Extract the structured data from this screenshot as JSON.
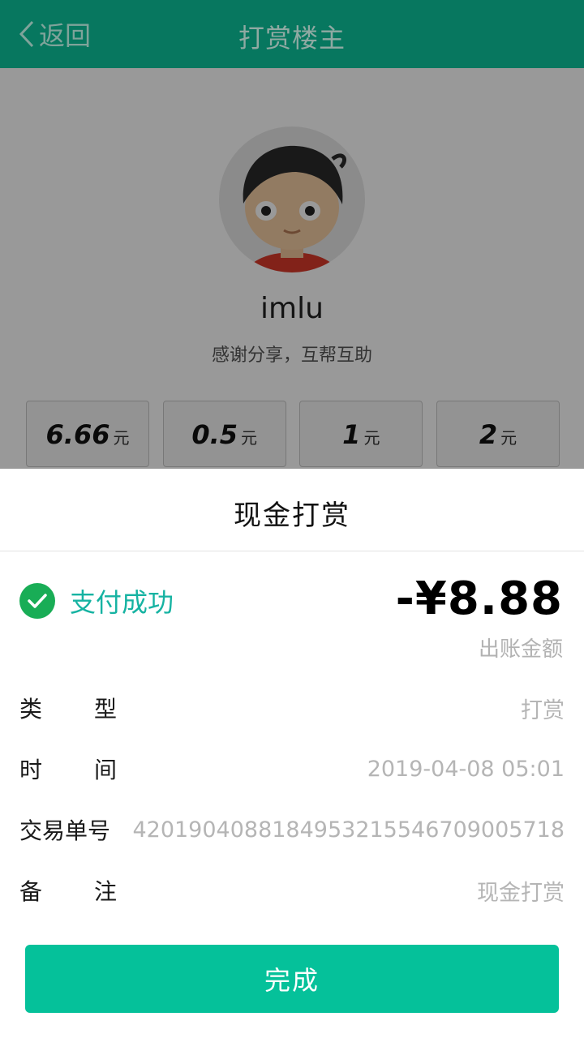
{
  "header": {
    "back_label": "返回",
    "title": "打赏楼主"
  },
  "profile": {
    "username": "imlu",
    "subtitle": "感谢分享，互帮互助"
  },
  "amount_options": [
    {
      "value": "6.66",
      "unit": "元"
    },
    {
      "value": "0.5",
      "unit": "元"
    },
    {
      "value": "1",
      "unit": "元"
    },
    {
      "value": "2",
      "unit": "元"
    }
  ],
  "sheet": {
    "title": "现金打赏",
    "status": "支付成功",
    "amount": "-¥8.88",
    "amount_label": "出账金额",
    "rows": [
      {
        "label": "类型",
        "value": "打赏"
      },
      {
        "label": "时间",
        "value": "2019-04-08 05:01"
      },
      {
        "label": "交易单号",
        "value": "4201904088184953215546709005718"
      },
      {
        "label": "备注",
        "value": "现金打赏"
      }
    ],
    "done_label": "完成"
  },
  "colors": {
    "header_bg": "#07775f",
    "success_green": "#19ad56",
    "status_text": "#16b3a2",
    "button_bg": "#05c19a"
  }
}
